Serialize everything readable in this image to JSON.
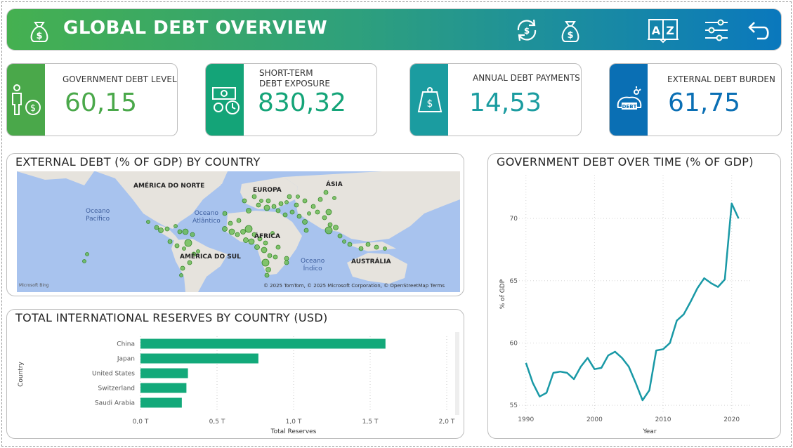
{
  "header": {
    "title": "GLOBAL DEBT OVERVIEW",
    "icons": [
      "money-bag-icon",
      "refresh-money-icon",
      "money-bag-icon",
      "dictionary-az-icon",
      "filter-sliders-icon",
      "back-arrow-icon"
    ],
    "colors": {
      "start": "#45b050",
      "end": "#0a78bd"
    }
  },
  "kpis": [
    {
      "label_line1": "GOVERNMENT DEBT LEVEL",
      "label_line2": "",
      "value": "60,15",
      "color": "#4aa84a",
      "icon": "person-money-icon"
    },
    {
      "label_line1": "SHORT-TERM",
      "label_line2": "DEBT EXPOSURE",
      "value": "830,32",
      "color": "#14a478",
      "icon": "cash-clock-icon"
    },
    {
      "label_line1": "ANNUAL DEBT PAYMENTS",
      "label_line2": "",
      "value": "14,53",
      "color": "#1b9ca0",
      "icon": "weight-dollar-icon"
    },
    {
      "label_line1": "EXTERNAL DEBT BURDEN",
      "label_line2": "",
      "value": "61,75",
      "color": "#0a6fb4",
      "icon": "debt-burden-icon"
    }
  ],
  "map_panel": {
    "title": "EXTERNAL DEBT (% OF GDP) BY COUNTRY",
    "continents": [
      "AMÉRICA DO NORTE",
      "EUROPA",
      "ÁSIA",
      "ÁFRICA",
      "AMÉRICA DO SUL",
      "AUSTRÁLIA"
    ],
    "oceans": [
      {
        "line1": "Oceano",
        "line2": "Pacífico"
      },
      {
        "line1": "Oceano",
        "line2": "Atlântico"
      },
      {
        "line1": "Oceano",
        "line2": "Índico"
      }
    ],
    "credit": "© 2025 TomTom, © 2025 Microsoft Corporation, © OpenStreetMap  Terms",
    "provider": "Microsoft Bing"
  },
  "bar_panel": {
    "title": "TOTAL INTERNATIONAL RESERVES BY COUNTRY (USD)",
    "chart_data": {
      "type": "bar",
      "orientation": "horizontal",
      "categories": [
        "China",
        "Japan",
        "United States",
        "Switzerland",
        "Saudi Arabia"
      ],
      "values": [
        1.6,
        0.77,
        0.31,
        0.3,
        0.27
      ],
      "xlabel": "Total Reserves",
      "ylabel": "Country",
      "xlim": [
        0,
        2.0
      ],
      "xticks": [
        "0,0 T",
        "0,5 T",
        "1,0 T",
        "1,5 T",
        "2,0 T"
      ],
      "grid": true,
      "color": "#13a97a"
    }
  },
  "line_panel": {
    "title": "GOVERNMENT DEBT OVER TIME (% OF GDP)",
    "chart_data": {
      "type": "line",
      "x": [
        1990,
        1991,
        1992,
        1993,
        1994,
        1995,
        1996,
        1997,
        1998,
        1999,
        2000,
        2001,
        2002,
        2003,
        2004,
        2005,
        2006,
        2007,
        2008,
        2009,
        2010,
        2011,
        2012,
        2013,
        2014,
        2015,
        2016,
        2017,
        2018,
        2019,
        2020,
        2021
      ],
      "y": [
        58.4,
        56.8,
        55.7,
        56.0,
        57.6,
        57.7,
        57.6,
        57.1,
        58.1,
        58.8,
        57.9,
        58.0,
        59.0,
        59.3,
        58.8,
        58.1,
        56.8,
        55.4,
        56.2,
        59.4,
        59.5,
        60.0,
        61.8,
        62.3,
        63.3,
        64.4,
        65.2,
        64.8,
        64.5,
        65.1,
        71.2,
        70.0
      ],
      "xlabel": "Year",
      "ylabel": "% of GDP",
      "xlim": [
        1989,
        2023
      ],
      "ylim": [
        54.5,
        73.5
      ],
      "xticks": [
        "1990",
        "2000",
        "2010",
        "2020"
      ],
      "yticks": [
        "55",
        "60",
        "65",
        "70"
      ],
      "grid": true,
      "color": "#1999a6"
    }
  }
}
